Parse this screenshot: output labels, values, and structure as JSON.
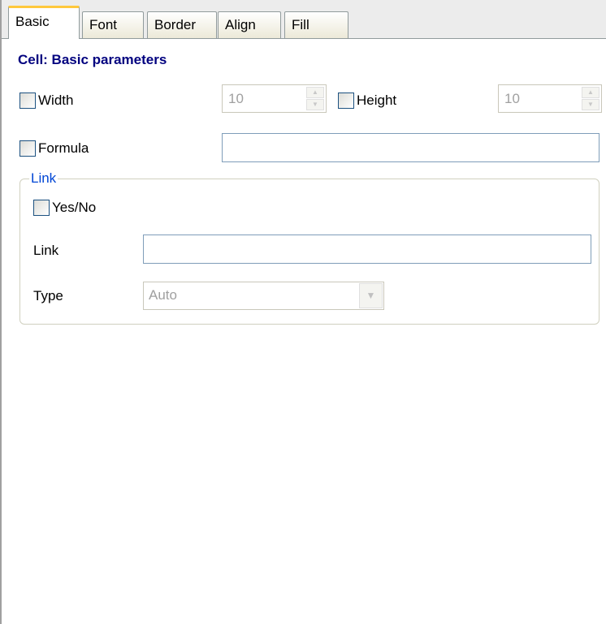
{
  "tabs": [
    {
      "label": "Basic",
      "active": true
    },
    {
      "label": "Font",
      "active": false
    },
    {
      "label": "Border",
      "active": false
    },
    {
      "label": "Align",
      "active": false
    },
    {
      "label": "Fill",
      "active": false
    }
  ],
  "section_title": "Cell: Basic parameters",
  "width": {
    "label": "Width",
    "checked": false,
    "value": "10"
  },
  "height": {
    "label": "Height",
    "checked": false,
    "value": "10"
  },
  "formula": {
    "label": "Formula",
    "checked": false,
    "value": ""
  },
  "link_group": {
    "legend": "Link",
    "yes_no": {
      "label": "Yes/No",
      "checked": false
    },
    "link": {
      "label": "Link",
      "value": ""
    },
    "type": {
      "label": "Type",
      "selected": "Auto"
    }
  },
  "colors": {
    "title": "#00007f",
    "legend": "#0046d5",
    "active_tab_accent": "#ffc83c",
    "disabled_text": "#a0a0a0"
  },
  "icons": {
    "spin_up": "arrow-up-icon",
    "spin_down": "arrow-down-icon",
    "combo_dropdown": "chevron-down-icon"
  }
}
